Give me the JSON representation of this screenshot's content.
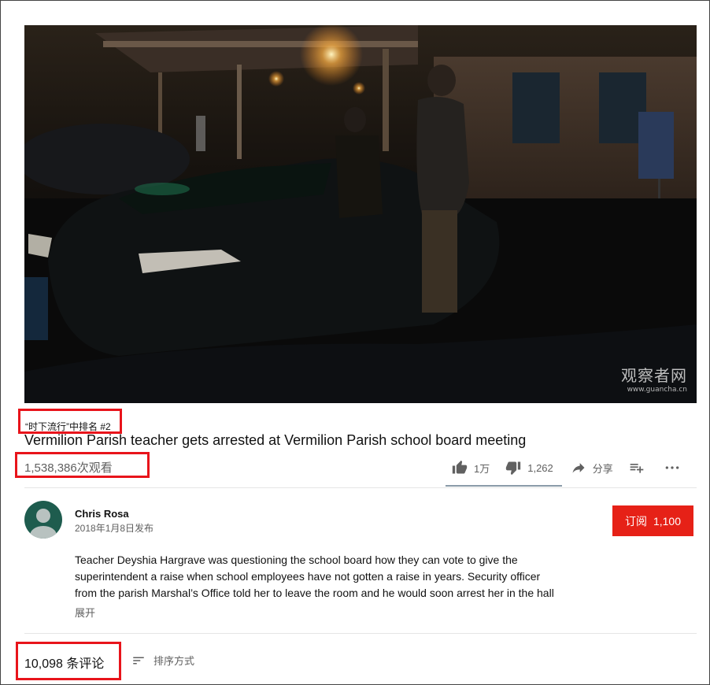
{
  "video": {
    "watermark_cn": "观察者网",
    "watermark_url": "www.guancha.cn"
  },
  "trending_label": "“时下流行”中排名 #2",
  "title": "Vermilion Parish teacher gets arrested at Vermilion Parish school board meeting",
  "views": "1,538,386次观看",
  "actions": {
    "like_count": "1万",
    "dislike_count": "1,262",
    "share_label": "分享",
    "like_ratio": 0.89
  },
  "channel": {
    "name": "Chris Rosa",
    "published": "2018年1月8日发布",
    "subscribe_label": "订阅",
    "subscriber_count": "1,100"
  },
  "description": {
    "lines": [
      "Teacher Deyshia Hargrave was questioning the school board how they can vote to give the",
      "superintendent a raise when school employees have not gotten a raise in years.  Security officer",
      "from the parish Marshal’s Office told her to leave the room and he would soon arrest her in the hall"
    ],
    "expand_label": "展开"
  },
  "comments": {
    "count_label": "10,098 条评论",
    "sort_label": "排序方式"
  },
  "colors": {
    "highlight_box": "#e8141b",
    "subscribe_bg": "#e62117",
    "muted_text": "#606060",
    "avatar_bg": "#1e5c4e"
  }
}
